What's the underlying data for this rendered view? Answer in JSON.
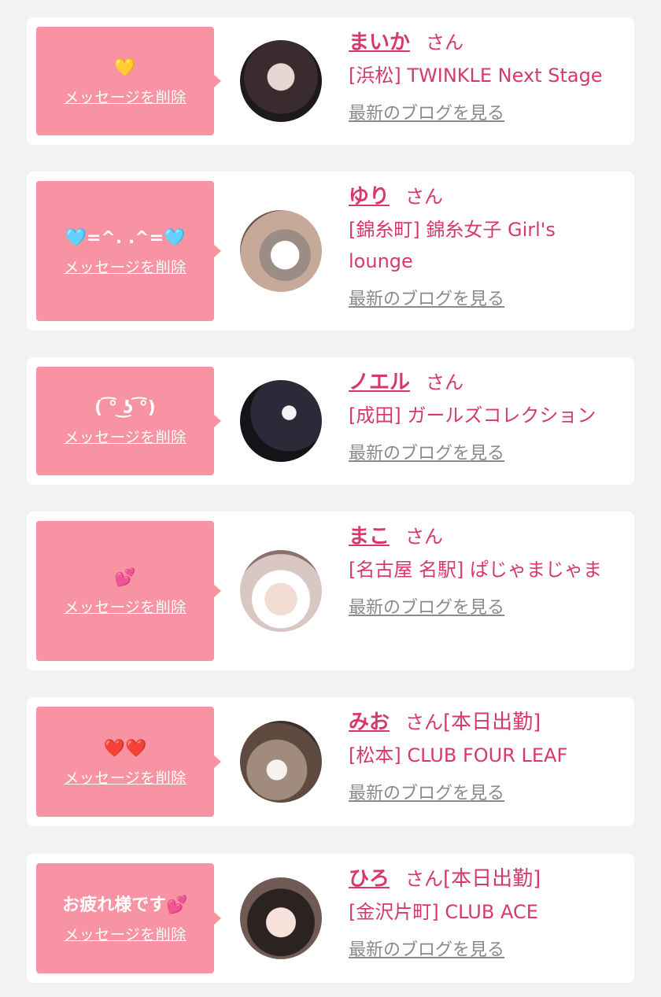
{
  "delete_label": "メッセージを削除",
  "blog_label": "最新のブログを見る",
  "san": "さん",
  "colors": {
    "bubble": "#f793a2",
    "accent": "#d63a6a",
    "link_gray": "#8a8a8a"
  },
  "items": [
    {
      "message": "💛",
      "name": "まいか",
      "status": "",
      "shop": "[浜松] TWINKLE Next Stage"
    },
    {
      "message": "🩵=^. .^=🩵",
      "name": "ゆり",
      "status": "",
      "shop": "[錦糸町] 錦糸女子 Girl's lounge"
    },
    {
      "message": "( ͡° ͜ʖ ͡°)",
      "name": "ノエル",
      "status": "",
      "shop": "[成田] ガールズコレクション"
    },
    {
      "message": "💕",
      "name": "まこ",
      "status": "",
      "shop": "[名古屋 名駅] ぱじゃまじゃま"
    },
    {
      "message": "❤️❤️",
      "name": "みお",
      "status": "[本日出勤]",
      "shop": "[松本] CLUB FOUR LEAF"
    },
    {
      "message": "お疲れ様です💕",
      "name": "ひろ",
      "status": "[本日出勤]",
      "shop": "[金沢片町] CLUB ACE"
    }
  ]
}
